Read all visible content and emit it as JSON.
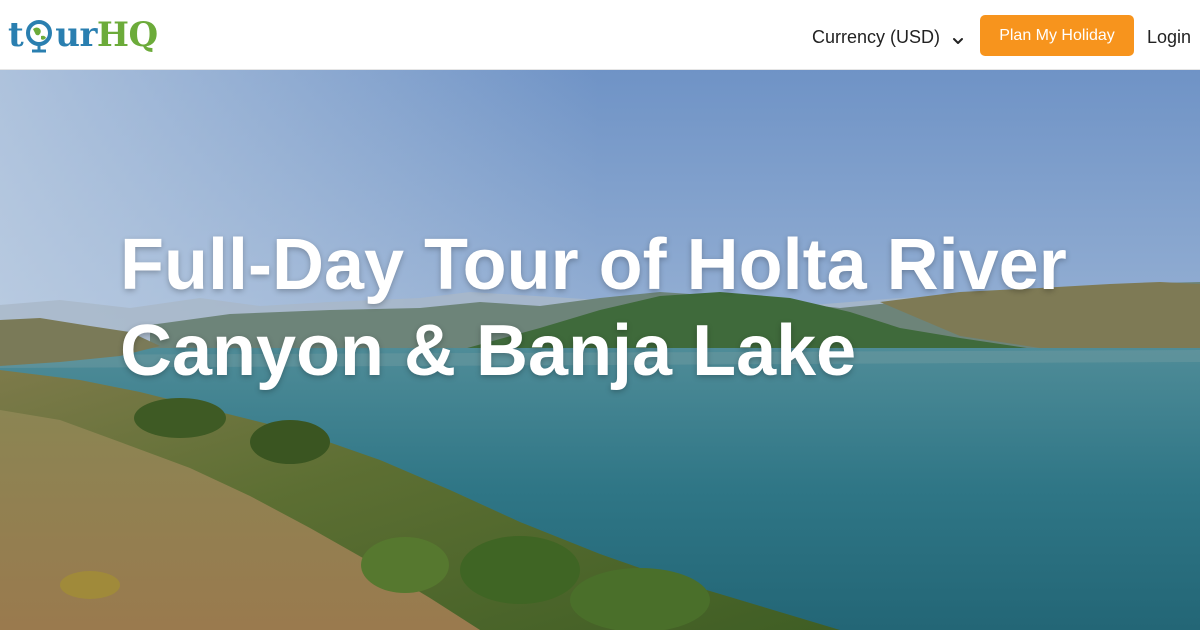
{
  "header": {
    "logo": {
      "text_t": "t",
      "text_ur": "ur",
      "text_hq": "HQ",
      "alt": "tourHQ",
      "colors": {
        "blue": "#2a7fb0",
        "green": "#6cab3a"
      },
      "icon": "globe-icon"
    },
    "currency": {
      "label": "Currency (USD)",
      "icon": "chevron-down-icon"
    },
    "plan_button": {
      "label": "Plan My Holiday",
      "color": "#f7941d"
    },
    "login_label": "Login"
  },
  "hero": {
    "title_line1": "Full-Day Tour of Holta River",
    "title_line2": "Canyon & Banja Lake",
    "background": "lake-landscape-photo"
  }
}
